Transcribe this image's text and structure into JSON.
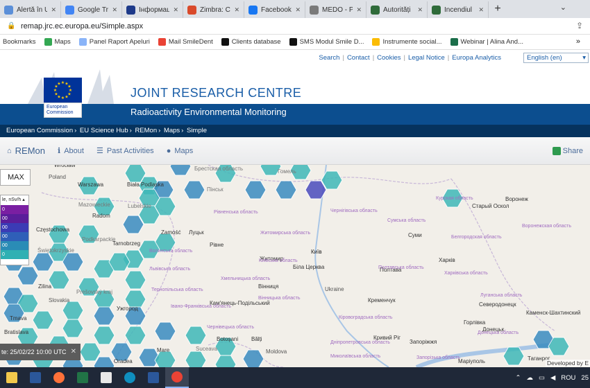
{
  "browser": {
    "tabs": [
      {
        "label": "Alertă în U",
        "color": "#5b8fd8"
      },
      {
        "label": "Google Tra",
        "color": "#4285f4"
      },
      {
        "label": "Інформаці",
        "color": "#1e3a8a"
      },
      {
        "label": "Zimbra: Co",
        "color": "#d94a2b"
      },
      {
        "label": "Facebook",
        "color": "#1877f2"
      },
      {
        "label": "MEDO - P",
        "color": "#7a7a7a"
      },
      {
        "label": "Autorități",
        "color": "#2f6b3a"
      },
      {
        "label": "Incendiul",
        "color": "#2f6b3a"
      }
    ],
    "new_tab": "+",
    "url": "remap.jrc.ec.europa.eu/Simple.aspx",
    "bookmarks": [
      {
        "label": "Bookmarks",
        "color": ""
      },
      {
        "label": "Maps",
        "color": "#34a853"
      },
      {
        "label": "Panel Raport Apeluri",
        "color": "#8ab4f8"
      },
      {
        "label": "Mail SmileDent",
        "color": "#ea4335"
      },
      {
        "label": "Clients database",
        "color": "#111111"
      },
      {
        "label": "SMS Modul Smile D...",
        "color": "#111111"
      },
      {
        "label": "Instrumente social...",
        "color": "#fbbc04"
      },
      {
        "label": "Webinar | Alina And...",
        "color": "#1b6e4a"
      }
    ],
    "more": "»"
  },
  "site": {
    "toplinks": [
      "Search",
      "Contact",
      "Cookies",
      "Legal Notice",
      "Europa Analytics"
    ],
    "language": "English (en)",
    "logo_text": "European Commission",
    "title": "JOINT RESEARCH CENTRE",
    "subtitle": "Radioactivity Environmental Monitoring",
    "breadcrumbs": [
      "European Commission",
      "EU Science Hub",
      "REMon",
      "Maps",
      "Simple"
    ],
    "nav": {
      "brand": "REMon",
      "about": "About",
      "past": "Past Activities",
      "maps": "Maps",
      "share": "Share"
    }
  },
  "map": {
    "max_label": "MAX",
    "legend_head": "le, nSv/h",
    "legend_rows": [
      {
        "label": "0",
        "color": "#7a1fa2"
      },
      {
        "label": "00",
        "color": "#5a1e9a"
      },
      {
        "label": "00",
        "color": "#3b3bb5"
      },
      {
        "label": "00",
        "color": "#2f5fb8"
      },
      {
        "label": "00",
        "color": "#2a8cb6"
      },
      {
        "label": "0",
        "color": "#2fb0b3"
      }
    ],
    "date": "te: 25/02/22 10:00 UTC",
    "date_close": "✕",
    "developed_by": "Developed by E",
    "places": [
      {
        "t": "Poland",
        "c": "#555"
      },
      {
        "t": "Warszawa",
        "c": "#333"
      },
      {
        "t": "Biała Podlaska",
        "c": "#333"
      },
      {
        "t": "Radom",
        "c": "#333"
      },
      {
        "t": "Częstochowa",
        "c": "#333"
      },
      {
        "t": "Tarnobrzeg",
        "c": "#333"
      },
      {
        "t": "Zamość",
        "c": "#333"
      },
      {
        "t": "Луцьк",
        "c": "#333"
      },
      {
        "t": "Рівне",
        "c": "#333"
      },
      {
        "t": "Житомир",
        "c": "#333"
      },
      {
        "t": "Київ",
        "c": "#222"
      },
      {
        "t": "Біла Церква",
        "c": "#333"
      },
      {
        "t": "Вінниця",
        "c": "#333"
      },
      {
        "t": "Ukraine",
        "c": "#555"
      },
      {
        "t": "Кременчук",
        "c": "#333"
      },
      {
        "t": "Суми",
        "c": "#333"
      },
      {
        "t": "Старый Оскол",
        "c": "#333"
      },
      {
        "t": "Воронеж",
        "c": "#333"
      },
      {
        "t": "Харків",
        "c": "#333"
      },
      {
        "t": "Полтава",
        "c": "#333"
      },
      {
        "t": "Кривий Ріг",
        "c": "#333"
      },
      {
        "t": "Запоріжжя",
        "c": "#333"
      },
      {
        "t": "Горлівка",
        "c": "#333"
      },
      {
        "t": "Северодонецк",
        "c": "#333"
      },
      {
        "t": "Каменск-Шахтинский",
        "c": "#333"
      },
      {
        "t": "Донецьк",
        "c": "#333"
      },
      {
        "t": "Маріуполь",
        "c": "#333"
      },
      {
        "t": "Таганрог",
        "c": "#333"
      },
      {
        "t": "Ужгород",
        "c": "#333"
      },
      {
        "t": "Кам'янець-Подільський",
        "c": "#333"
      },
      {
        "t": "Slovakia",
        "c": "#555"
      },
      {
        "t": "Prešovský kraj",
        "c": "#777"
      },
      {
        "t": "Moldova",
        "c": "#555"
      },
      {
        "t": "Bălți",
        "c": "#333"
      },
      {
        "t": "Botoșani",
        "c": "#333"
      },
      {
        "t": "Suceava",
        "c": "#777"
      },
      {
        "t": "Mare",
        "c": "#333"
      },
      {
        "t": "Oradea",
        "c": "#333"
      },
      {
        "t": "Tmava",
        "c": "#333"
      },
      {
        "t": "Bratislava",
        "c": "#333"
      },
      {
        "t": "Zilina",
        "c": "#333"
      },
      {
        "t": "Гомель",
        "c": "#777"
      },
      {
        "t": "Пінськ",
        "c": "#777"
      },
      {
        "t": "Брестская область",
        "c": "#777"
      },
      {
        "t": "Wrocław",
        "c": "#333"
      },
      {
        "t": "Чернігівська область",
        "c": "#a06cc0"
      },
      {
        "t": "Сумська область",
        "c": "#a06cc0"
      },
      {
        "t": "Рівненська область",
        "c": "#a06cc0"
      },
      {
        "t": "Житомирська область",
        "c": "#a06cc0"
      },
      {
        "t": "Київська область",
        "c": "#a06cc0"
      },
      {
        "t": "Хмельницька область",
        "c": "#a06cc0"
      },
      {
        "t": "Вінницька область",
        "c": "#a06cc0"
      },
      {
        "t": "Полтавська область",
        "c": "#a06cc0"
      },
      {
        "t": "Харківська область",
        "c": "#a06cc0"
      },
      {
        "t": "Кіровоградська область",
        "c": "#a06cc0"
      },
      {
        "t": "Дніпропетровська область",
        "c": "#a06cc0"
      },
      {
        "t": "Луганська область",
        "c": "#a06cc0"
      },
      {
        "t": "Белгородская область",
        "c": "#a06cc0"
      },
      {
        "t": "Воронежская область",
        "c": "#a06cc0"
      },
      {
        "t": "Курская область",
        "c": "#a06cc0"
      },
      {
        "t": "Львівська область",
        "c": "#a06cc0"
      },
      {
        "t": "Тернопільська область",
        "c": "#a06cc0"
      },
      {
        "t": "Івано-Франківська область",
        "c": "#a06cc0"
      },
      {
        "t": "Чернівецька область",
        "c": "#a06cc0"
      },
      {
        "t": "Миколаївська область",
        "c": "#a06cc0"
      },
      {
        "t": "Запорізька область",
        "c": "#a06cc0"
      },
      {
        "t": "Донецька область",
        "c": "#a06cc0"
      },
      {
        "t": "Волинська область",
        "c": "#a06cc0"
      },
      {
        "t": "Świętokrzyskie",
        "c": "#777"
      },
      {
        "t": "Podkarpackie",
        "c": "#777"
      },
      {
        "t": "Mazowieckie",
        "c": "#777"
      },
      {
        "t": "Lubelskie",
        "c": "#777"
      }
    ]
  },
  "taskbar": {
    "apps": [
      {
        "name": "file-explorer-app-icon",
        "color": "#f2c94c"
      },
      {
        "name": "word-app-icon",
        "color": "#2b579a"
      },
      {
        "name": "firefox-app-icon",
        "color": "#ff7139"
      },
      {
        "name": "excel-app-icon",
        "color": "#217346"
      },
      {
        "name": "notepad-app-icon",
        "color": "#e8e8e8"
      },
      {
        "name": "edge-app-icon",
        "color": "#0f8fbf"
      },
      {
        "name": "word-doc-app-icon",
        "color": "#2b579a"
      },
      {
        "name": "chrome-app-icon",
        "color": "#ea4335"
      }
    ],
    "language": "ROU",
    "clock": "25"
  }
}
